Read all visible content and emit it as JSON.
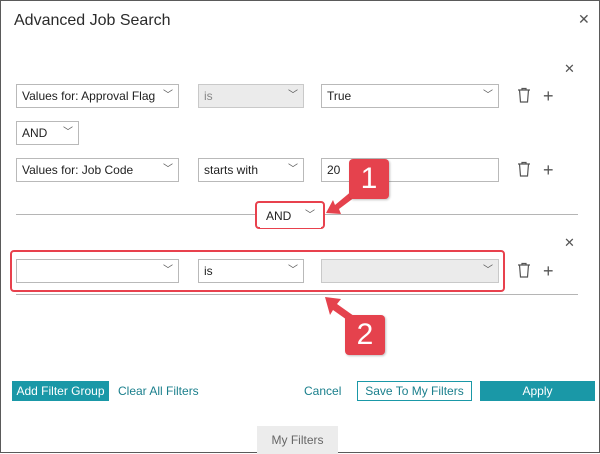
{
  "dialog": {
    "title": "Advanced Job Search"
  },
  "group1": {
    "row1": {
      "field": "Values for:  Approval Flag",
      "operator": "is",
      "value": "True"
    },
    "connector": "AND",
    "row2": {
      "field": "Values for:  Job Code",
      "operator": "starts with",
      "value": "20"
    }
  },
  "group_connector": "AND",
  "group2": {
    "row1": {
      "field": "",
      "operator": "is",
      "value": ""
    }
  },
  "annotations": {
    "badge1": "1",
    "badge2": "2"
  },
  "footer": {
    "add_filter_group": "Add Filter Group",
    "clear_all": "Clear All Filters",
    "cancel": "Cancel",
    "save": "Save To My Filters",
    "apply": "Apply"
  },
  "tab": {
    "my_filters": "My Filters"
  },
  "colors": {
    "accent": "#1a98a7",
    "highlight": "#e5424d"
  }
}
